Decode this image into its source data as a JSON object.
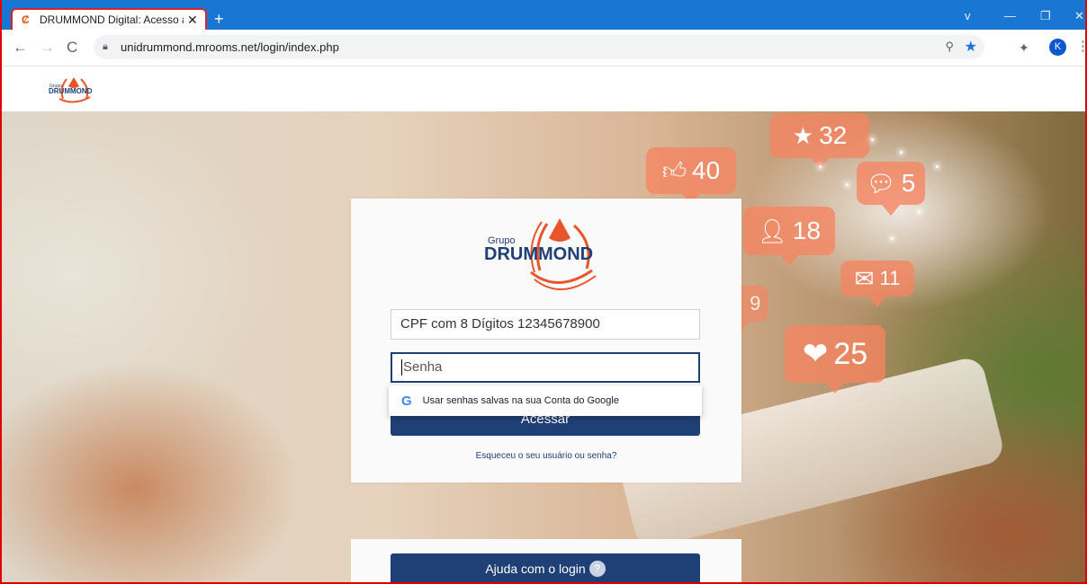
{
  "browser": {
    "tab_title": "DRUMMOND Digital: Acesso ao",
    "new_tab": "+",
    "url": "unidrummond.mrooms.net/login/index.php",
    "avatar_letter": "K",
    "window_controls": [
      "v",
      "—",
      "❐",
      "✕"
    ]
  },
  "site": {
    "brand_small": "Grupo",
    "brand_name": "DRUMMOND"
  },
  "login": {
    "logo_prefix": "Grupo",
    "logo_name": "DRUMMOND",
    "username_value": "CPF com 8 Dígitos 12345678900",
    "password_placeholder": "Senha",
    "password_suggestion": "Usar senhas salvas na sua Conta do Google",
    "submit_label": "Acessar",
    "forgot_link": "Esqueceu o seu usuário ou senha?"
  },
  "help": {
    "button_label": "Ajuda com o login"
  },
  "background_badges": {
    "star": "32",
    "like": "40",
    "comment": "5",
    "person": "18",
    "mail": "11",
    "emoji": "9",
    "heart": "25"
  },
  "colors": {
    "brand_blue": "#1f4077",
    "brand_orange": "#e8552b",
    "browser_blue": "#1976d2"
  }
}
